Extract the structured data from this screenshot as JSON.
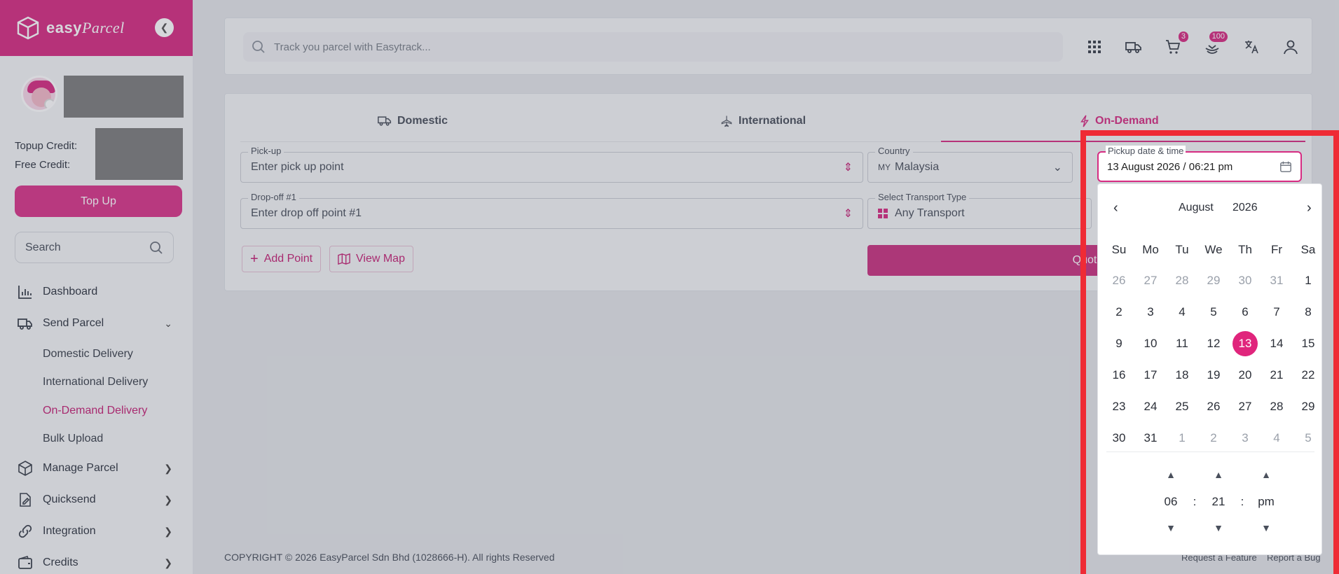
{
  "brand": {
    "name": "easy",
    "name_script": "Parcel",
    "accent": "#d62c82"
  },
  "sidebar": {
    "topup_credit_label": "Topup Credit:",
    "free_credit_label": "Free Credit:",
    "topup_button": "Top Up",
    "search_placeholder": "Search",
    "nav": {
      "dashboard": "Dashboard",
      "send_parcel": "Send Parcel",
      "domestic": "Domestic Delivery",
      "international": "International Delivery",
      "on_demand": "On-Demand Delivery",
      "bulk": "Bulk Upload",
      "manage": "Manage Parcel",
      "quicksend": "Quicksend",
      "integration": "Integration",
      "credits": "Credits"
    }
  },
  "topbar": {
    "track_placeholder": "Track you parcel with Easytrack...",
    "cart_count": "3",
    "notification_count": "100"
  },
  "tabs": {
    "domestic": "Domestic",
    "international": "International",
    "on_demand": "On-Demand"
  },
  "form": {
    "pickup_label": "Pick-up",
    "pickup_placeholder": "Enter pick up point",
    "dropoff_label": "Drop-off #1",
    "dropoff_placeholder": "Enter drop off point #1",
    "country_label": "Country",
    "country_code": "MY",
    "country_value": "Malaysia",
    "transport_label": "Select Transport Type",
    "transport_value": "Any Transport",
    "add_point": "Add Point",
    "view_map": "View Map",
    "quote_button": "Quot"
  },
  "datepicker": {
    "label": "Pickup date & time",
    "value": "13 August 2026 / 06:21 pm",
    "month": "August",
    "year": "2026",
    "weekdays": [
      "Su",
      "Mo",
      "Tu",
      "We",
      "Th",
      "Fr",
      "Sa"
    ],
    "weeks": [
      [
        "26",
        "27",
        "28",
        "29",
        "30",
        "31",
        "1"
      ],
      [
        "2",
        "3",
        "4",
        "5",
        "6",
        "7",
        "8"
      ],
      [
        "9",
        "10",
        "11",
        "12",
        "13",
        "14",
        "15"
      ],
      [
        "16",
        "17",
        "18",
        "19",
        "20",
        "21",
        "22"
      ],
      [
        "23",
        "24",
        "25",
        "26",
        "27",
        "28",
        "29"
      ],
      [
        "30",
        "31",
        "1",
        "2",
        "3",
        "4",
        "5"
      ]
    ],
    "selected_day": "13",
    "hour": "06",
    "minute": "21",
    "period": "pm",
    "time_sep": ":"
  },
  "footer": {
    "copyright": "COPYRIGHT © 2026 EasyParcel Sdn Bhd (1028666-H). All rights Reserved",
    "request_feature": "Request a Feature",
    "report_bug": "Report a Bug"
  }
}
